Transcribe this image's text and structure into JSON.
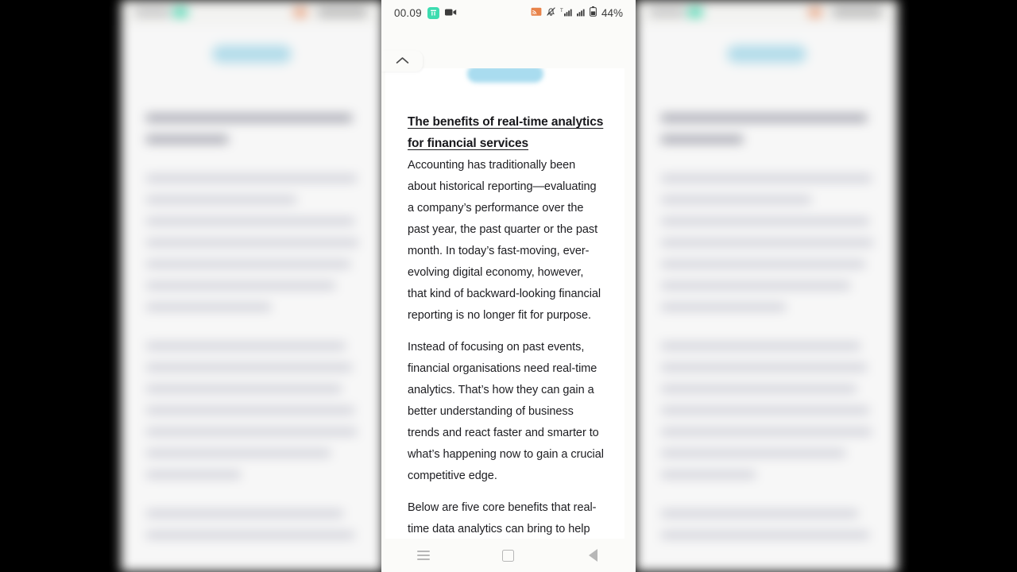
{
  "statusbar": {
    "clock": "00.09",
    "app_icon_name": "green-app-icon",
    "video_icon_name": "video-camera-icon",
    "cast_icon_name": "screen-cast-icon",
    "mute_icon_name": "notification-muted-icon",
    "signal1_icon_name": "signal-bars-sim1-icon",
    "signal2_icon_name": "signal-bars-sim2-icon",
    "battery_icon_name": "battery-icon",
    "battery_percent": "44%"
  },
  "collapse_tab": {
    "icon_name": "chevron-up-icon",
    "label": "^"
  },
  "document": {
    "title": "The benefits of real-time analytics for financial services",
    "paragraphs": [
      "Accounting has traditionally been about historical reporting—evaluating a company’s performance over the past year, the past quarter or the past month. In today’s fast-moving, ever-evolving digital economy, however, that kind of backward-looking financial reporting is no longer fit for purpose.",
      "Instead of focusing on past events, financial organisations need real-time analytics. That’s how they can gain a better understanding of business trends and react faster and smarter to what’s happening now to gain a crucial competitive edge.",
      "Below are five core benefits that real-time data analytics can bring to help"
    ]
  },
  "navbar": {
    "recents_label": "Recents",
    "home_label": "Home",
    "back_label": "Back"
  },
  "colors": {
    "accent_pill": "#a9dcef",
    "app_green": "#3ddcb0",
    "text": "#1d1d21",
    "page_bg": "#fbfbf9",
    "card_bg": "#ffffff",
    "letterbox": "#000000",
    "scrollbar": "#c8c8c8"
  }
}
